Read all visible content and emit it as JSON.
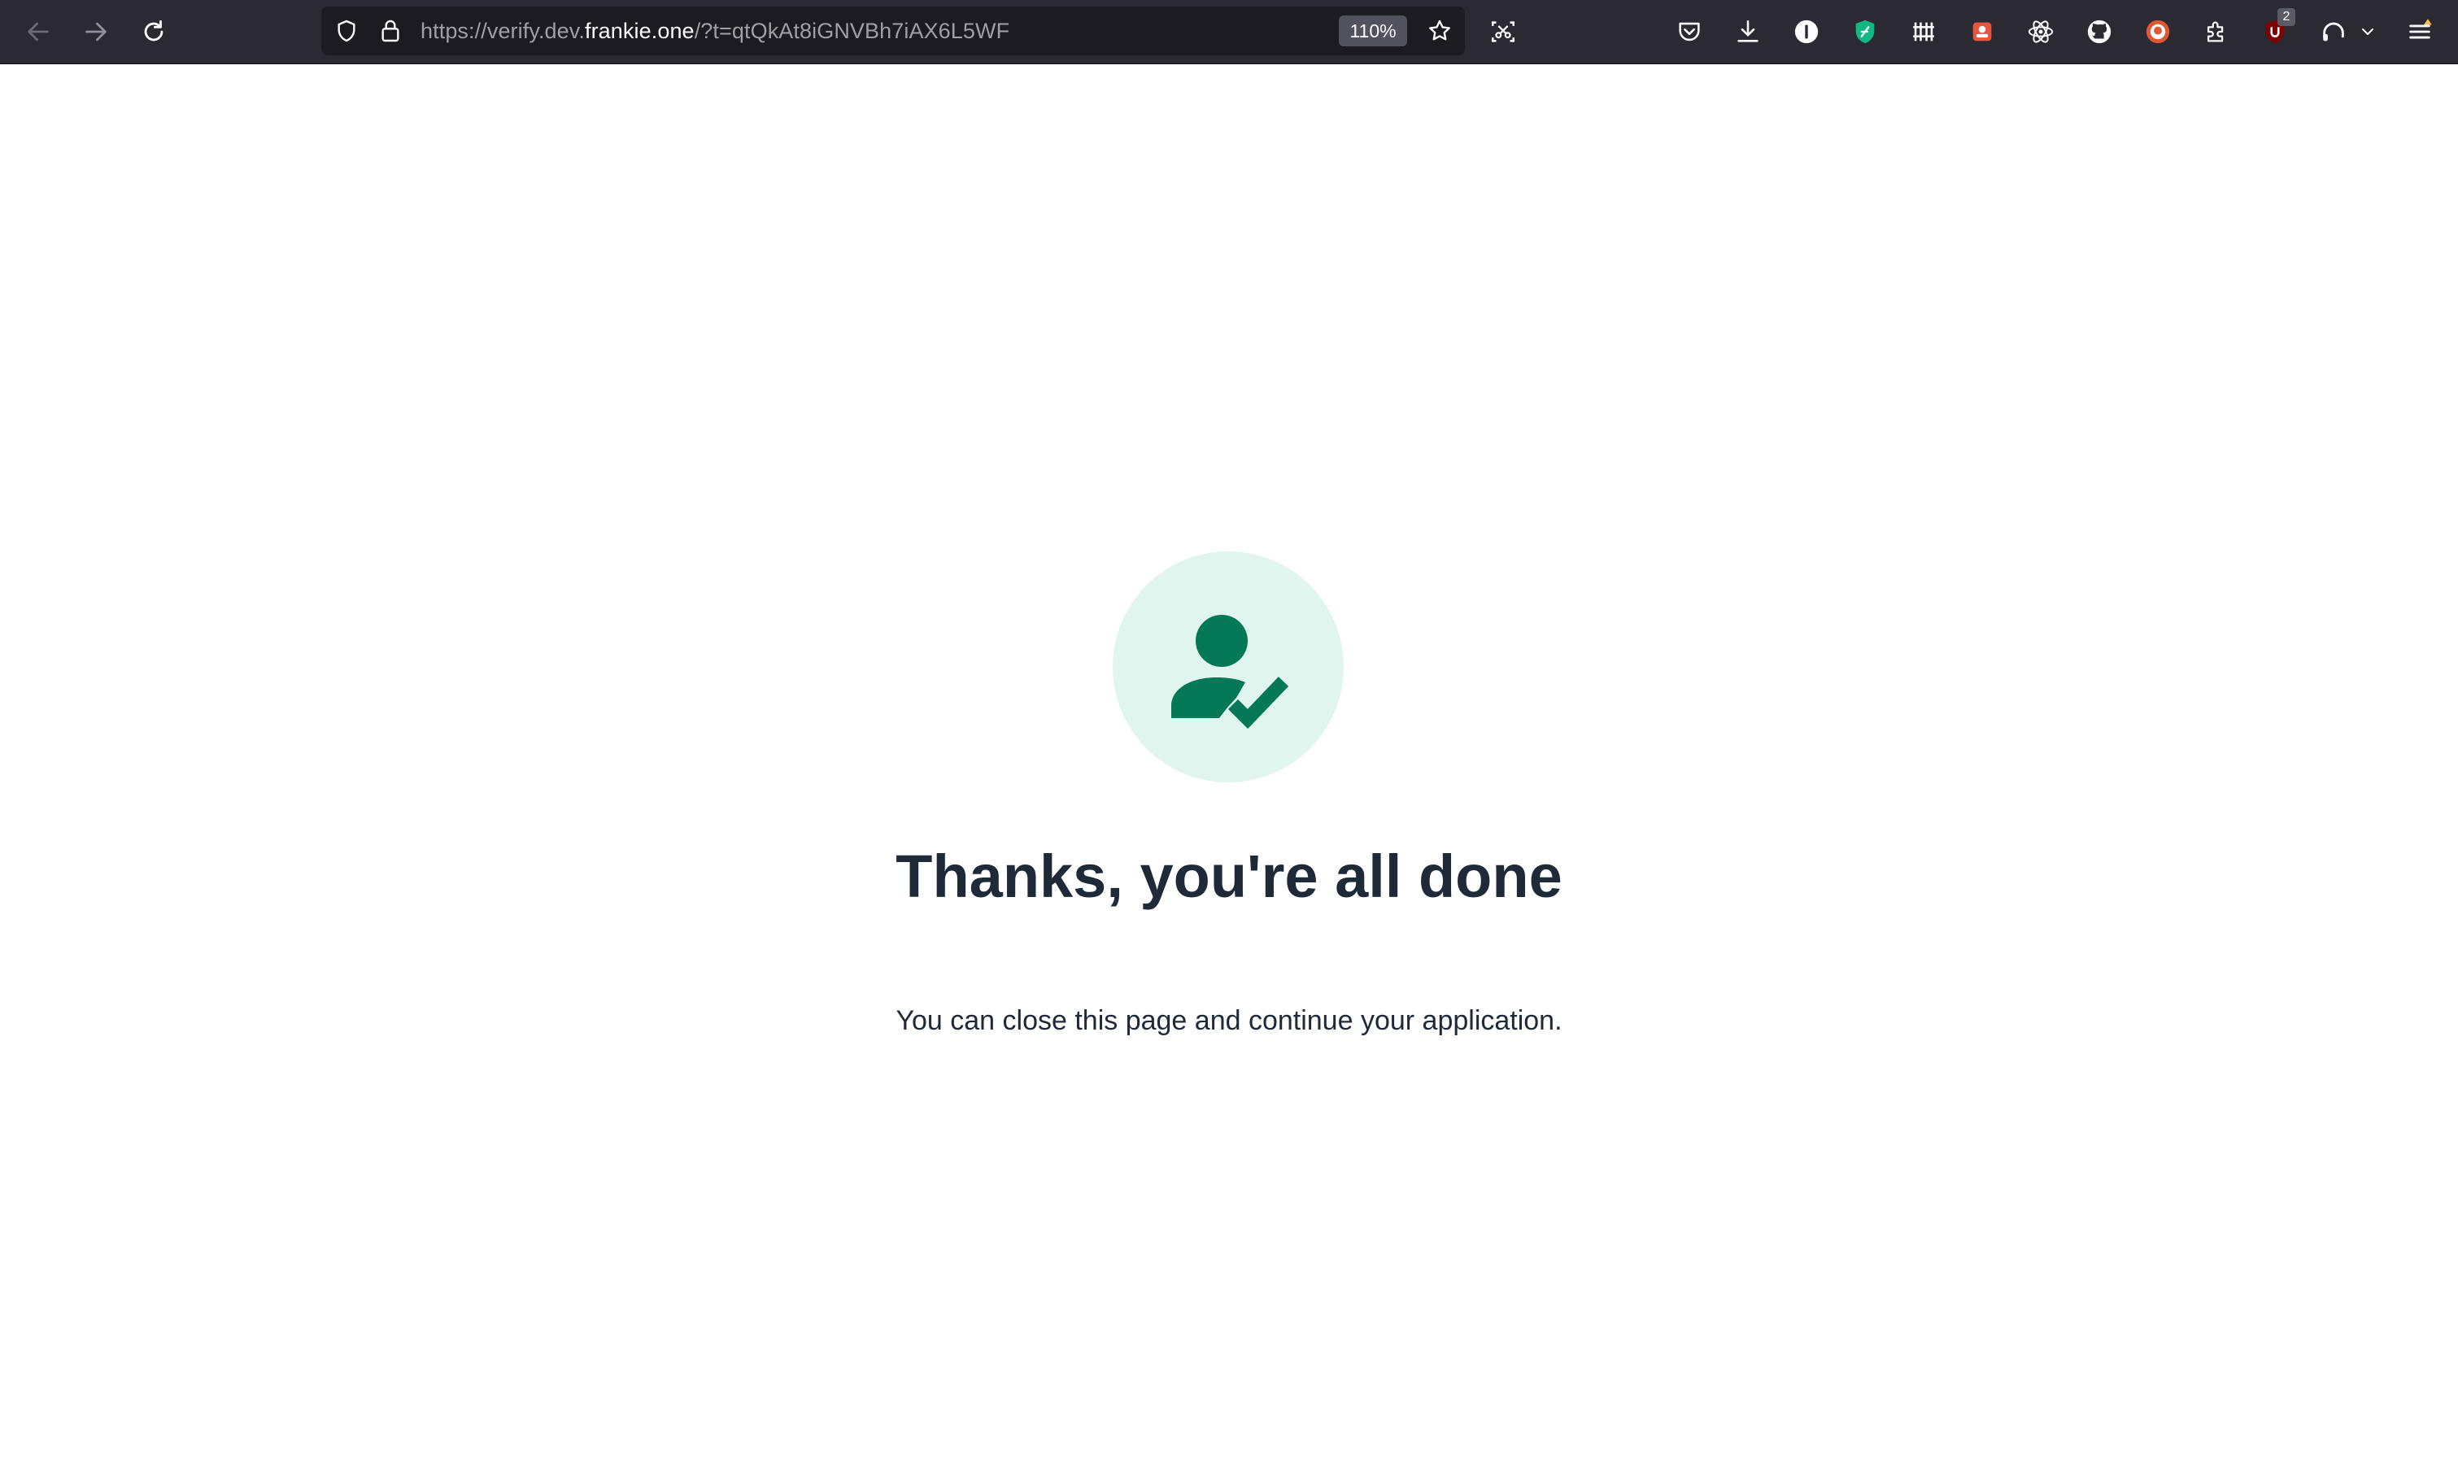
{
  "browser": {
    "url": {
      "prefix": "https://verify.dev.",
      "host": "frankie.one",
      "suffix": "/?t=qtQkAt8iGNVBh7iAX6L5WF"
    },
    "zoom_label": "110%",
    "extension_badge_count": "2",
    "toolbar_icons": [
      "back-arrow-icon",
      "forward-arrow-icon",
      "reload-icon",
      "tracking-shield-icon",
      "lock-icon",
      "bookmark-star-icon",
      "screenshot-icon",
      "pocket-icon",
      "download-icon",
      "info-icon",
      "shield-extension-icon",
      "grid-extension-icon",
      "red-extension-icon",
      "react-devtools-icon",
      "github-icon",
      "duckduckgo-icon",
      "extensions-puzzle-icon",
      "ublock-icon",
      "headphones-icon",
      "chevron-down-icon",
      "hamburger-menu-icon"
    ]
  },
  "page": {
    "icon": "user-check-icon",
    "title": "Thanks, you're all done",
    "subtitle": "You can close this page and continue your application."
  },
  "colors": {
    "toolbar_bg": "#2b2a33",
    "urlbar_bg": "#1c1b22",
    "icon_circle_bg": "#e0f5ed",
    "icon_green": "#047857",
    "text_dark": "#1e2a38"
  }
}
